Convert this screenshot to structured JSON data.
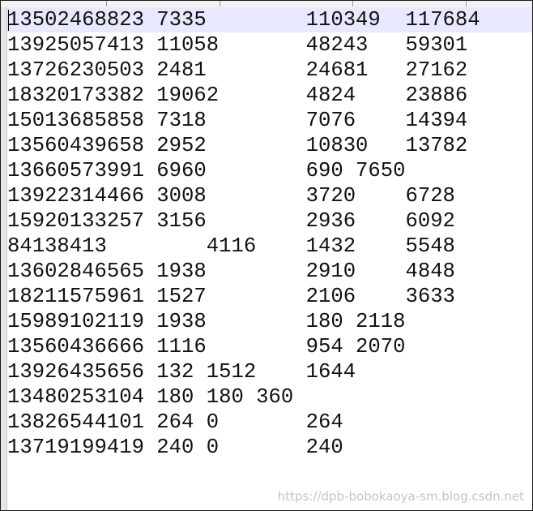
{
  "editor": {
    "lines": [
      "13502468823 7335\t110349\t117684",
      "13925057413 11058\t48243\t59301",
      "13726230503 2481\t24681\t27162",
      "18320173382 19062\t4824\t23886",
      "15013685858 7318\t7076\t14394",
      "13560439658 2952\t10830\t13782",
      "13660573991 6960\t690 7650",
      "13922314466 3008\t3720\t6728",
      "15920133257 3156\t2936\t6092",
      "84138413\t4116\t1432\t5548",
      "13602846565 1938\t2910\t4848",
      "18211575961 1527\t2106\t3633",
      "15989102119 1938\t180 2118",
      "13560436666 1116\t954 2070",
      "13926435656 132 1512\t1644",
      "13480253104 180 180 360",
      "13826544101 264 0\t264",
      "13719199419 240 0\t240"
    ]
  },
  "watermark": "https://dpb-bobokaoya-sm.blog.csdn.net",
  "colors": {
    "current_line_highlight": "#e8e8ff",
    "text": "#111111",
    "gutter": "#e6e6e6",
    "watermark": "#c4c4c4"
  }
}
